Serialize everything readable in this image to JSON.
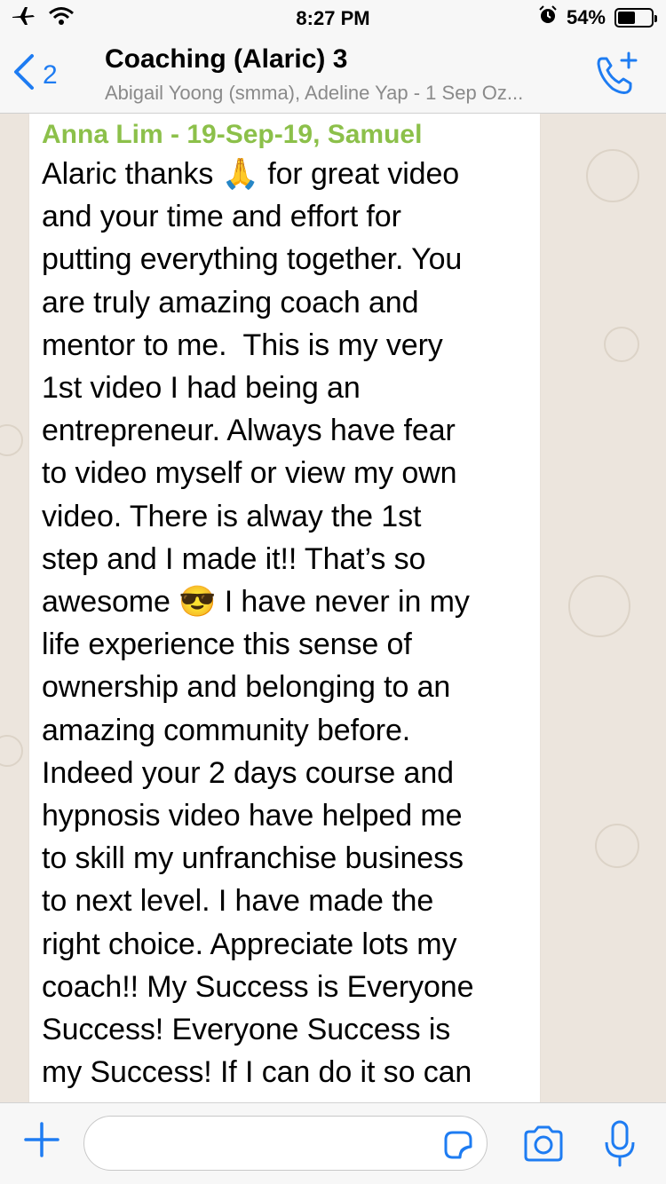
{
  "status_bar": {
    "time": "8:27 PM",
    "battery_text": "54%",
    "battery_level": 0.54,
    "icons": [
      "airplane-icon",
      "wifi-icon",
      "alarm-icon",
      "battery-icon"
    ]
  },
  "header": {
    "back_count": "2",
    "title": "Coaching (Alaric) 3",
    "subtitle": "Abigail Yoong (smma), Adeline Yap - 1 Sep Oz...",
    "icons": [
      "chevron-left-icon",
      "add-call-icon"
    ]
  },
  "message": {
    "sender": "Anna Lim - 19-Sep-19, Samuel",
    "text": "Alaric thanks 🙏 for great video\nand your time and effort for\nputting everything together. You\nare truly amazing coach and\nmentor to me.  This is my very\n1st video I had being an\nentrepreneur. Always have fear\nto video myself or view my own\nvideo. There is alway the 1st\nstep and I made it!! That’s so\nawesome 😎 I have never in my\nlife experience this sense of\nownership and belonging to an\namazing community before.\nIndeed your 2 days course and\nhypnosis video have helped me\nto skill my unfranchise business\nto next level. I have made the\nright choice. Appreciate lots my\ncoach!! My Success is Everyone\nSuccess! Everyone Success is\nmy Success! If I can do it so can"
  },
  "input_bar": {
    "placeholder": "",
    "icons": [
      "plus-icon",
      "sticker-icon",
      "camera-icon",
      "microphone-icon"
    ]
  },
  "colors": {
    "accent": "#1e7cf2",
    "sender_name": "#8cc04a",
    "chat_background": "#ece5dd",
    "bar_background": "#f7f7f7"
  }
}
